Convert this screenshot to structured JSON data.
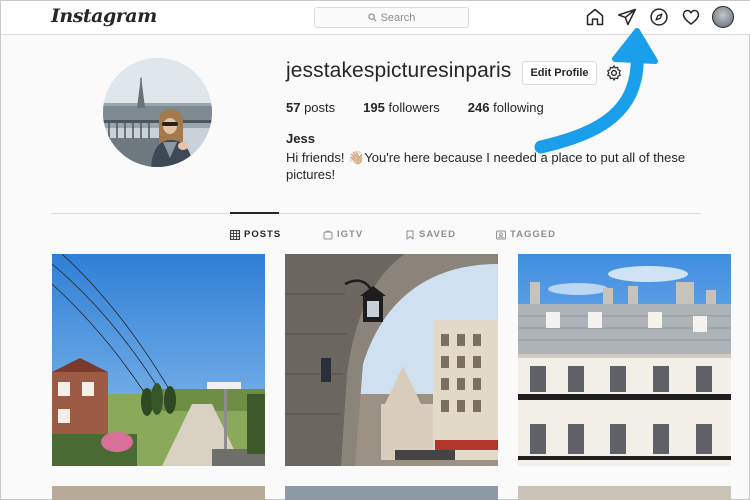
{
  "nav": {
    "logo": "Instagram",
    "search_placeholder": "Search",
    "icons": [
      "home-icon",
      "direct-message-icon",
      "explore-icon",
      "activity-heart-icon",
      "profile-avatar"
    ]
  },
  "profile": {
    "username": "jesstakespicturesinparis",
    "edit_label": "Edit Profile",
    "stats": [
      {
        "count": "57",
        "label": " posts"
      },
      {
        "count": "195",
        "label": " followers"
      },
      {
        "count": "246",
        "label": " following"
      }
    ],
    "full_name": "Jess",
    "bio": "Hi friends! 👋🏼You're here because I needed a place to put all of these pictures!"
  },
  "tabs": [
    {
      "label": "POSTS",
      "active": true
    },
    {
      "label": "IGTV",
      "active": false
    },
    {
      "label": "SAVED",
      "active": false
    },
    {
      "label": "TAGGED",
      "active": false
    }
  ],
  "posts": [
    {
      "subject": "country road with brick house and blue sky"
    },
    {
      "subject": "paris street viewed under archway with lantern"
    },
    {
      "subject": "haussmann building facade with blue sky"
    }
  ],
  "colors": {
    "accent_arrow": "#1aa0ea",
    "border": "#dbdbdb",
    "text": "#262626",
    "muted": "#8e8e8e"
  }
}
